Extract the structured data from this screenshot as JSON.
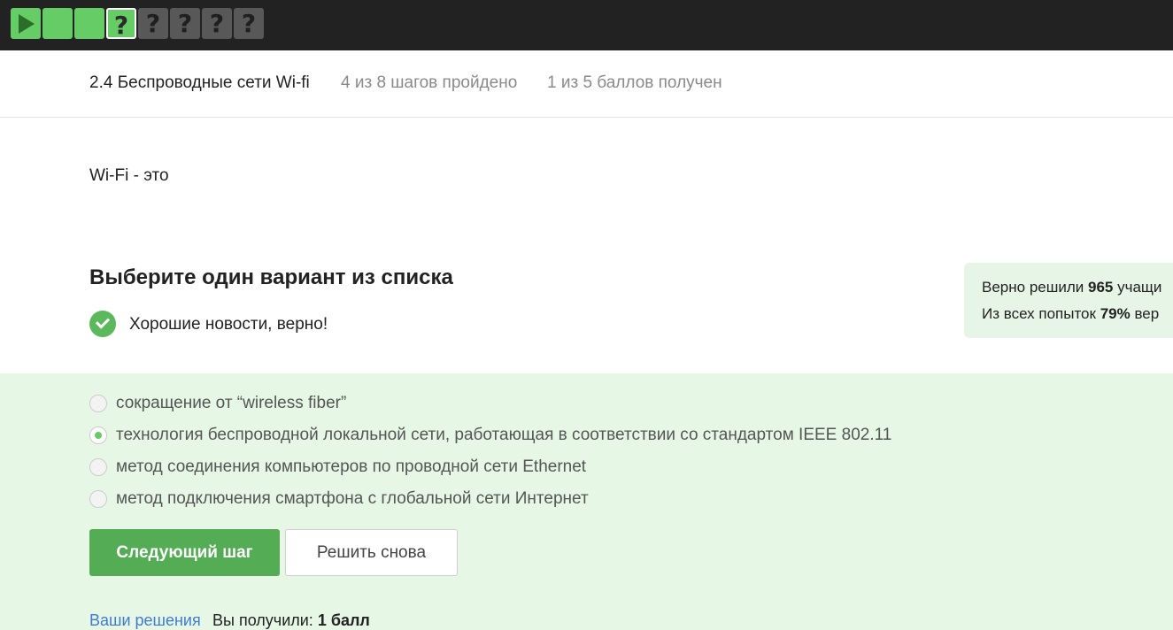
{
  "step_bar": {
    "steps": [
      {
        "type": "video",
        "state": "done",
        "icon": "play-icon",
        "label": ""
      },
      {
        "type": "text",
        "state": "done",
        "label": ""
      },
      {
        "type": "text",
        "state": "done",
        "label": ""
      },
      {
        "type": "quiz",
        "state": "current",
        "label": "?"
      },
      {
        "type": "quiz",
        "state": "pending",
        "label": "?"
      },
      {
        "type": "quiz",
        "state": "pending",
        "label": "?"
      },
      {
        "type": "quiz",
        "state": "pending",
        "label": "?"
      },
      {
        "type": "quiz",
        "state": "pending",
        "label": "?"
      }
    ],
    "colors": {
      "done": "#66cc66",
      "pending": "#585858",
      "bar": "#222222"
    }
  },
  "lesson": {
    "title": "2.4 Беспроводные сети Wi-fi",
    "progress": "4 из 8 шагов пройдено",
    "score": "1 из 5 баллов  получен"
  },
  "question": {
    "text": "Wi-Fi - это"
  },
  "task": {
    "title": "Выберите один вариант из списка",
    "feedback": "Хорошие новости, верно!"
  },
  "stats": {
    "line1_prefix": "Верно решили ",
    "line1_value": "965",
    "line1_suffix": " учащи",
    "line2_prefix": "Из всех попыток ",
    "line2_value": "79%",
    "line2_suffix": " вер"
  },
  "options": [
    {
      "label": "сокращение от “wireless fiber”",
      "checked": false
    },
    {
      "label": "технология беспроводной локальной сети, работающая в соответствии со стандартом IEEE 802.11",
      "checked": true
    },
    {
      "label": "метод соединения компьютеров по проводной сети Ethernet",
      "checked": false
    },
    {
      "label": "метод подключения смартфона с глобальной сети Интернет",
      "checked": false
    }
  ],
  "buttons": {
    "next": "Следующий шаг",
    "retry": "Решить снова"
  },
  "footer": {
    "solutions_link": "Ваши решения",
    "received_prefix": "Вы получили: ",
    "received_value": "1 балл"
  },
  "colors": {
    "accent_green": "#54ad54",
    "answer_bg": "#e6f7e6",
    "link_blue": "#3f7bd1"
  }
}
